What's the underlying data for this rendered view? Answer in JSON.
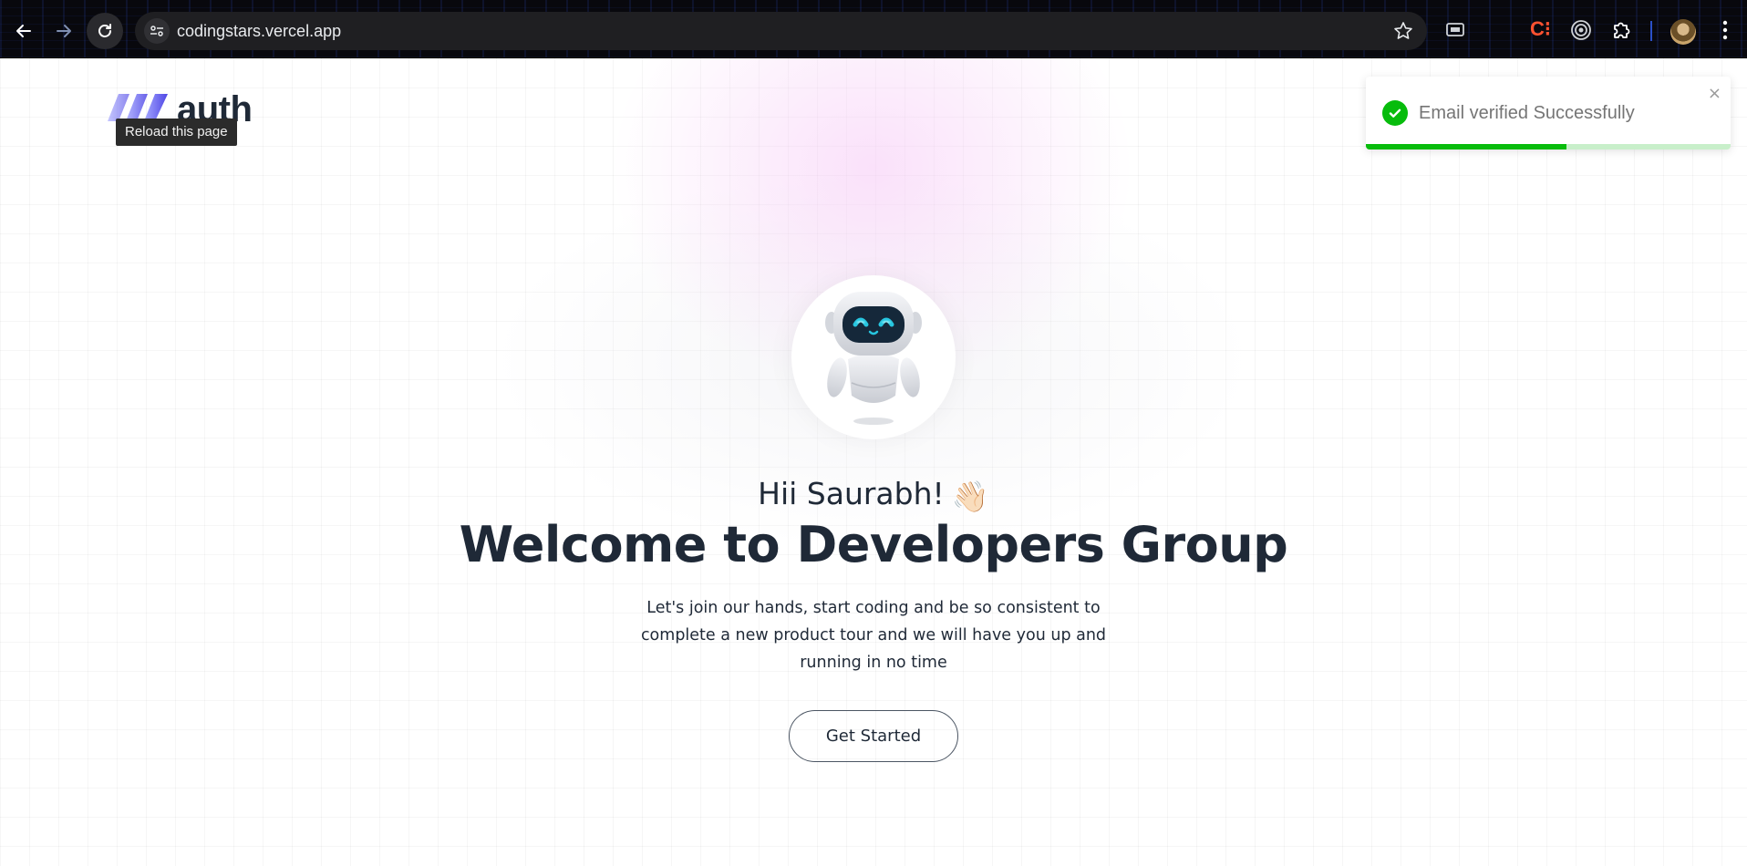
{
  "browser": {
    "url": "codingstars.vercel.app",
    "tooltip": "Reload this page",
    "extension_codetime_label": "C⁝",
    "icons": [
      "back-arrow-icon",
      "forward-arrow-icon",
      "reload-icon",
      "site-info-icon",
      "star-icon",
      "wallet-icon",
      "codetime-icon",
      "target-icon",
      "puzzle-icon",
      "profile-avatar",
      "more-vert-icon"
    ]
  },
  "page": {
    "logo_text": "auth",
    "toast": {
      "message": "Email verified Successfully",
      "close_symbol": "×",
      "progress": 0.55,
      "success_color": "#07bc0c"
    },
    "greeting": "Hii Saurabh!",
    "greeting_emoji": "👋🏻",
    "title": "Welcome to Developers Group",
    "description": "Let's join our hands, start coding and be so consistent to complete a new product tour and we will have you up and running in no time",
    "cta_label": "Get Started",
    "colors": {
      "logo_accent": "#5b5cf6",
      "text_dark": "#1f2937",
      "glow": "#f6c8f6"
    }
  }
}
